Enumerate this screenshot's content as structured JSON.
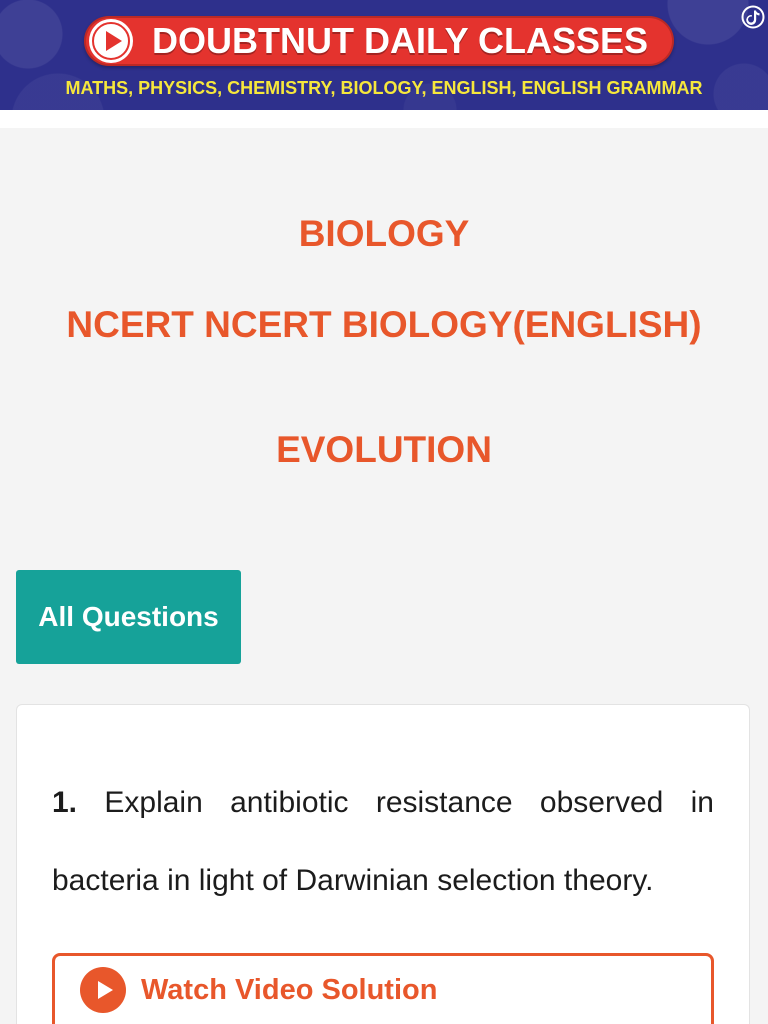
{
  "banner": {
    "title": "DOUBTNUT DAILY CLASSES",
    "subtitle": "MATHS, PHYSICS, CHEMISTRY, BIOLOGY, ENGLISH, ENGLISH GRAMMAR",
    "icons": {
      "play": "play-icon",
      "corner": "tiktok-icon"
    }
  },
  "header": {
    "subject": "BIOLOGY",
    "book": "NCERT NCERT BIOLOGY(ENGLISH)",
    "chapter": "EVOLUTION"
  },
  "filter": {
    "all_questions_label": "All Questions"
  },
  "questions": [
    {
      "number": "1.",
      "text": "Explain antibiotic resistance observed in bacteria in light of Darwinian selection theory.",
      "solution_button": {
        "label": "Watch Video Solution",
        "icon": "play-circle-icon"
      }
    }
  ],
  "theme": {
    "banner_background": "#2e308c",
    "banner_pill": "#e4332e",
    "banner_subtitle": "#f6e73c",
    "accent": "#e8572b",
    "button_teal": "#16a299",
    "page_background": "#f4f4f4",
    "card_background": "#ffffff",
    "text": "#1c1c1c"
  }
}
